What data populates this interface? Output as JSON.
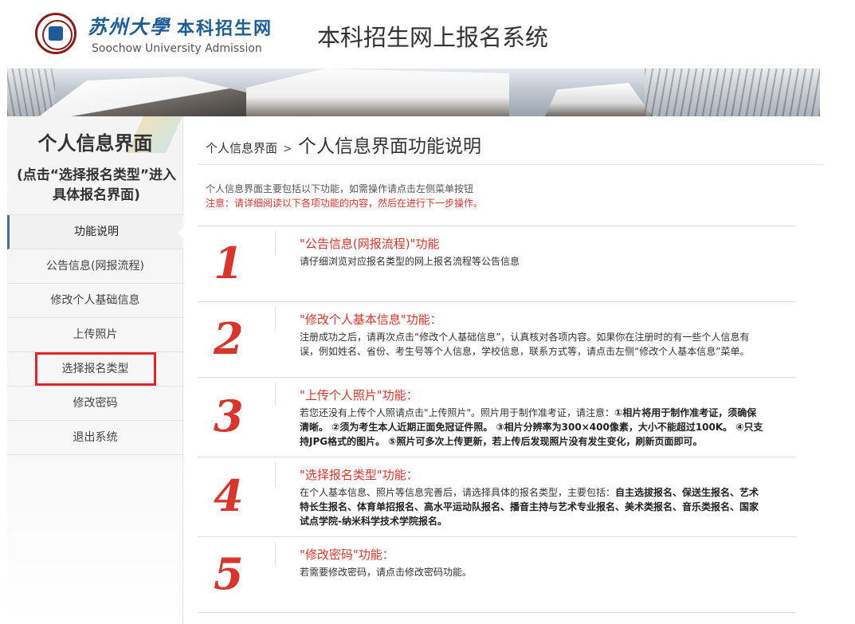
{
  "header": {
    "logo_cn": "苏州大學",
    "logo_net": "本科招生网",
    "logo_en": "Soochow University Admission",
    "system_title": "本科招生网上报名系统"
  },
  "sidebar": {
    "title": "个人信息界面",
    "subtitle": "(点击“选择报名类型”进入具体报名界面)",
    "items": [
      {
        "label": "功能说明"
      },
      {
        "label": "公告信息(网报流程)"
      },
      {
        "label": "修改个人基础信息"
      },
      {
        "label": "上传照片"
      },
      {
        "label": "选择报名类型"
      },
      {
        "label": "修改密码"
      },
      {
        "label": "退出系统"
      }
    ]
  },
  "breadcrumb": {
    "parent": "个人信息界面",
    "separator": ">",
    "current": "个人信息界面功能说明"
  },
  "intro": {
    "line1": "个人信息界面主要包括以下功能，如需操作请点击左侧菜单按钮",
    "line2": "注意：请详细阅读以下各项功能的内容，然后在进行下一步操作。"
  },
  "sections": [
    {
      "number": "1",
      "heading": "\"公告信息(网报流程)\"功能",
      "text": "请仔细浏览对应报名类型的网上报名流程等公告信息"
    },
    {
      "number": "2",
      "heading": "\"修改个人基本信息\"功能：",
      "text": "注册成功之后，请再次点击“修改个人基础信息”，认真核对各项内容。如果你在注册时的有一些个人信息有误，例如姓名、省份、考生号等个人信息，学校信息，联系方式等，请点击左侧“修改个人基本信息”菜单。"
    },
    {
      "number": "3",
      "heading": "\"上传个人照片\"功能：",
      "text_plain": "若您还没有上传个人照请点击\"上传照片\"。照片用于制作准考证，请注意：",
      "text_bold": "①相片将用于制作准考证，须确保清晰。 ②须为考生本人近期正面免冠证件照。 ③相片分辨率为300×400像素，大小不能超过100K。 ④只支持JPG格式的图片。 ⑤照片可多次上传更新，若上传后发现照片没有发生变化，刷新页面即可。"
    },
    {
      "number": "4",
      "heading": "\"选择报名类型\"功能：",
      "text_plain": "在个人基本信息、照片等信息完善后，请选择具体的报名类型，主要包括：",
      "text_bold": "自主选拔报名、保送生报名、艺术特长生报名、体育单招报名、高水平运动队报名、播音主持与艺术专业报名、美术类报名、音乐类报名、国家试点学院-纳米科学技术学院报名。"
    },
    {
      "number": "5",
      "heading": "\"修改密码\"功能：",
      "text": "若需要修改密码，请点击修改密码功能。"
    }
  ],
  "colors": {
    "accent_red": "#d6362c",
    "highlight_box": "#e0262b",
    "logo_blue": "#1e5d93"
  }
}
